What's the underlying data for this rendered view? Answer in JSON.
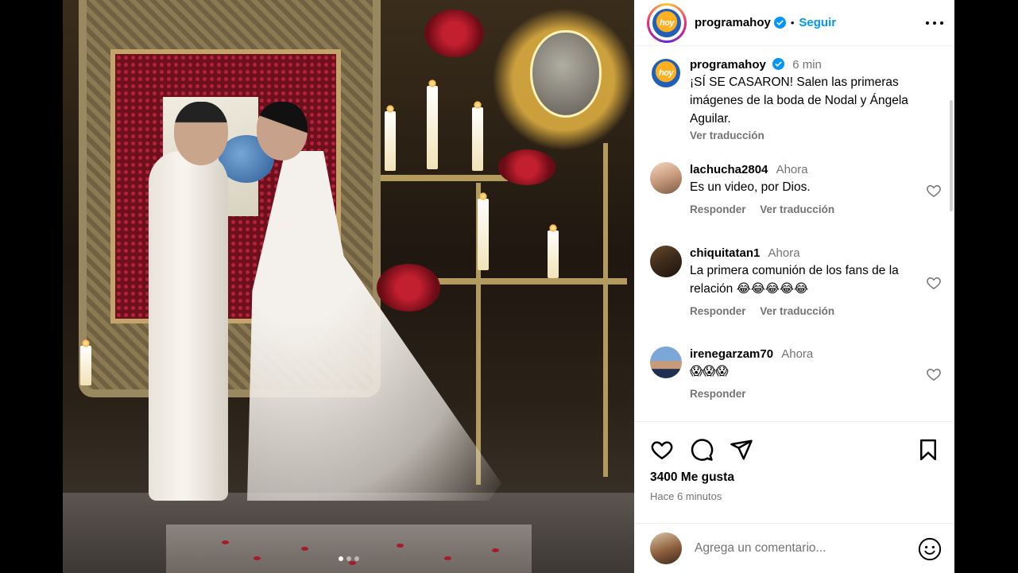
{
  "post": {
    "username": "programahoy",
    "follow_label": "Seguir",
    "separator": "•",
    "logo_text": "hoy"
  },
  "caption": {
    "username": "programahoy",
    "time": "6 min",
    "text": "¡SÍ SE CASARON! Salen las primeras imágenes de la boda de Nodal y Ángela Aguilar.",
    "translate": "Ver traducción"
  },
  "comments": [
    {
      "username": "lachucha2804",
      "time": "Ahora",
      "text": "Es un video, por Dios.",
      "reply": "Responder",
      "translate": "Ver traducción"
    },
    {
      "username": "chiquitatan1",
      "time": "Ahora",
      "text": "La primera comunión de los fans de la relación 😂😂😂😂😂",
      "reply": "Responder",
      "translate": "Ver traducción"
    },
    {
      "username": "irenegarzam70",
      "time": "Ahora",
      "text": "😱😱😱",
      "reply": "Responder"
    }
  ],
  "likes": "3400 Me gusta",
  "posted_ago": "Hace 6 minutos",
  "compose": {
    "placeholder": "Agrega un comentario..."
  },
  "carousel": {
    "count": 3,
    "active": 1
  },
  "colors": {
    "link": "#0095f6",
    "muted": "#737373"
  }
}
